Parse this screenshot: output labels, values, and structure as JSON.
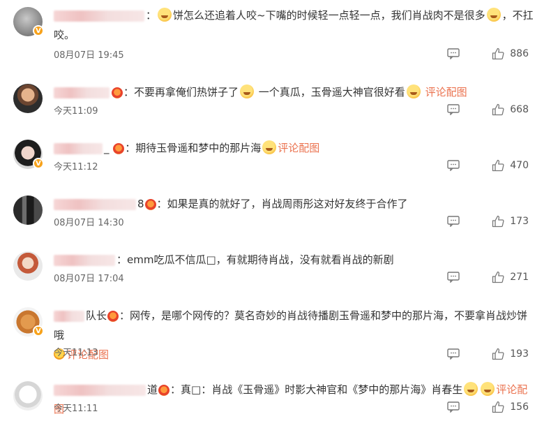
{
  "comments": [
    {
      "text": "饼怎么还追着人咬~下嘴的时候轻一点轻一点，我们肖战肉不是很多",
      "text_tail": "，不扛咬。",
      "time": "08月07日 19:45",
      "likes": "886",
      "has_badge": true,
      "has_vip": false,
      "link": ""
    },
    {
      "text": "：不要再拿俺们热饼子了",
      "text_tail": "一个真瓜，玉骨遥大神官很好看",
      "time": "今天11:09",
      "likes": "668",
      "has_badge": false,
      "has_vip": true,
      "link": "评论配图"
    },
    {
      "text": "：期待玉骨遥和梦中的那片海",
      "text_tail": "",
      "time": "今天11:12",
      "likes": "470",
      "has_badge": true,
      "has_vip": true,
      "link": "评论配图"
    },
    {
      "text": "：如果是真的就好了，肖战周雨彤这对好友终于合作了",
      "text_tail": "",
      "time": "08月07日 14:30",
      "likes": "173",
      "has_badge": false,
      "has_vip": true,
      "link": ""
    },
    {
      "text": "：emm吃瓜不信瓜□，有就期待肖战，没有就看肖战的新剧",
      "text_tail": "",
      "time": "08月07日 17:04",
      "likes": "271",
      "has_badge": false,
      "has_vip": false,
      "link": ""
    },
    {
      "text": "：网传，是哪个网传的？莫名奇妙的肖战待播剧玉骨遥和梦中的那片海，不要拿肖战炒饼哦",
      "text_tail": "",
      "time": "今天11:13",
      "likes": "193",
      "has_badge": true,
      "has_vip": true,
      "link": "评论配图",
      "name_suffix": "队长"
    },
    {
      "text": "：真□：肖战《玉骨遥》时影大神官和《梦中的那片海》肖春生",
      "text_tail": "",
      "time": "今天11:11",
      "likes": "156",
      "has_badge": false,
      "has_vip": true,
      "link": "评论配图",
      "name_suffix": "道"
    }
  ],
  "icons": {
    "reply": "comment-bubble-icon",
    "like": "thumbs-up-icon",
    "verified": "v-badge-icon"
  },
  "colors": {
    "accent": "#eb7350",
    "badge": "#f7a21b",
    "text": "#333333",
    "muted": "#666666"
  },
  "badge_letter": "V"
}
